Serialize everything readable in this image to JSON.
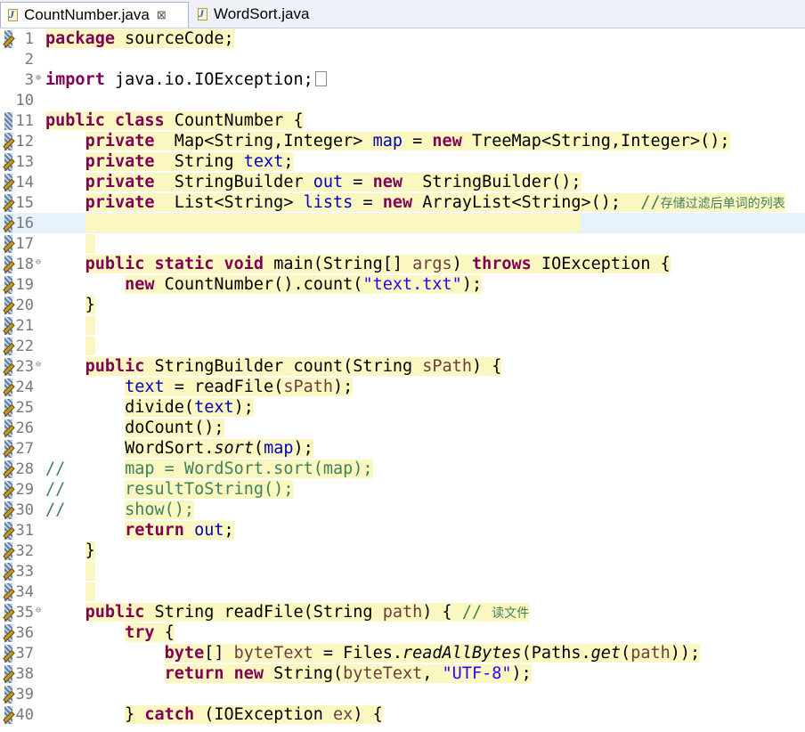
{
  "tabs": [
    {
      "label": "CountNumber.java",
      "close": "⊠",
      "active": true
    },
    {
      "label": "WordSort.java",
      "active": false
    }
  ],
  "editor": {
    "lines": [
      {
        "no": "1",
        "html": "<span class='hl'><span class='kw'>package</span> sourceCode;</span>"
      },
      {
        "no": "2",
        "html": ""
      },
      {
        "no": "3",
        "html": "<span class='kw'>import</span> java.io.IOException;<span class='boxmark'></span>"
      },
      {
        "no": "10",
        "html": ""
      },
      {
        "no": "11",
        "html": "<span class='hl'><span class='kw'>public</span> <span class='kw'>class</span> CountNumber {</span>"
      },
      {
        "no": "12",
        "html": "    <span class='hl'><span class='kw'>private</span>  Map&lt;String,Integer&gt; <span class='fld'>map</span> = <span class='kw'>new</span> TreeMap&lt;String,Integer&gt;();</span>"
      },
      {
        "no": "13",
        "html": "    <span class='hl'><span class='kw'>private</span>  String <span class='fld'>text</span>;</span>"
      },
      {
        "no": "14",
        "html": "    <span class='hl'><span class='kw'>private</span>  StringBuilder <span class='fld'>out</span> = <span class='kw'>new</span>  StringBuilder();</span>"
      },
      {
        "no": "15",
        "html": "    <span class='hl'><span class='kw'>private</span>  List&lt;String&gt; <span class='fld'>lists</span> = <span class='kw'>new</span> ArrayList&lt;String&gt;();  <span class='cmt'>//<span class='cjk'>存储过滤后单词的列表</span></span></span>"
      },
      {
        "no": "16",
        "html": "    <span class='hl'>                                                  </span>",
        "current": true
      },
      {
        "no": "17",
        "html": "    <span class='hl'> </span>"
      },
      {
        "no": "18",
        "html": "    <span class='hl'><span class='kw'>public</span> <span class='kw'>static</span> <span class='kw'>void</span> main(String[] <span class='par'>args</span>) <span class='kw'>throws</span> IOException {</span>"
      },
      {
        "no": "19",
        "html": "        <span class='hl'><span class='kw'>new</span> CountNumber().count(<span class='str'>\"text.txt\"</span>);</span>"
      },
      {
        "no": "20",
        "html": "    <span class='hl'>}</span>"
      },
      {
        "no": "21",
        "html": "    <span class='hl'> </span>"
      },
      {
        "no": "22",
        "html": "    <span class='hl'> </span>"
      },
      {
        "no": "23",
        "html": "    <span class='hl'><span class='kw'>public</span> StringBuilder count(String <span class='par'>sPath</span>) {</span>"
      },
      {
        "no": "24",
        "html": "        <span class='hl'><span class='fld'>text</span> = readFile(<span class='par'>sPath</span>);</span>"
      },
      {
        "no": "25",
        "html": "        <span class='hl'>divide(<span class='fld'>text</span>);</span>"
      },
      {
        "no": "26",
        "html": "        <span class='hl'>doCount();</span>"
      },
      {
        "no": "27",
        "html": "        <span class='hl'>WordSort.<span class='ita'>sort</span>(<span class='fld'>map</span>);</span>"
      },
      {
        "no": "28",
        "html": "<span class='cmark'>//</span>      <span class='hl cmt'>map = WordSort.sort(map);</span>"
      },
      {
        "no": "29",
        "html": "<span class='cmark'>//</span>      <span class='hl cmt'>resultToString();</span>"
      },
      {
        "no": "30",
        "html": "<span class='cmark'>//</span>      <span class='hl cmt'>show();</span>"
      },
      {
        "no": "31",
        "html": "        <span class='hl'><span class='kw'>return</span> <span class='fld'>out</span>;</span>"
      },
      {
        "no": "32",
        "html": "    <span class='hl'>}</span>"
      },
      {
        "no": "33",
        "html": "    <span class='hl'> </span>"
      },
      {
        "no": "34",
        "html": "    <span class='hl'> </span>"
      },
      {
        "no": "35",
        "html": "    <span class='hl'><span class='kw'>public</span> String readFile(String <span class='par'>path</span>) { <span class='cmt'>// <span class='cjk'>读文件</span></span></span>"
      },
      {
        "no": "36",
        "html": "        <span class='hl'><span class='kw'>try</span> {</span>"
      },
      {
        "no": "37",
        "html": "            <span class='hl'><span class='kw'>byte</span>[] <span class='par'>byteText</span> = Files.<span class='ita'>readAllBytes</span>(Paths.<span class='ita'>get</span>(<span class='par'>path</span>));</span>"
      },
      {
        "no": "38",
        "html": "            <span class='hl'><span class='kw'>return</span> <span class='kw'>new</span> String(<span class='par'>byteText</span>, <span class='str'>\"UTF-8\"</span>);</span>"
      },
      {
        "no": "39",
        "html": ""
      },
      {
        "no": "40",
        "html": "        <span class='hl'>} <span class='kw'>catch</span> (IOException <span class='par'>ex</span>) {</span>"
      }
    ]
  }
}
